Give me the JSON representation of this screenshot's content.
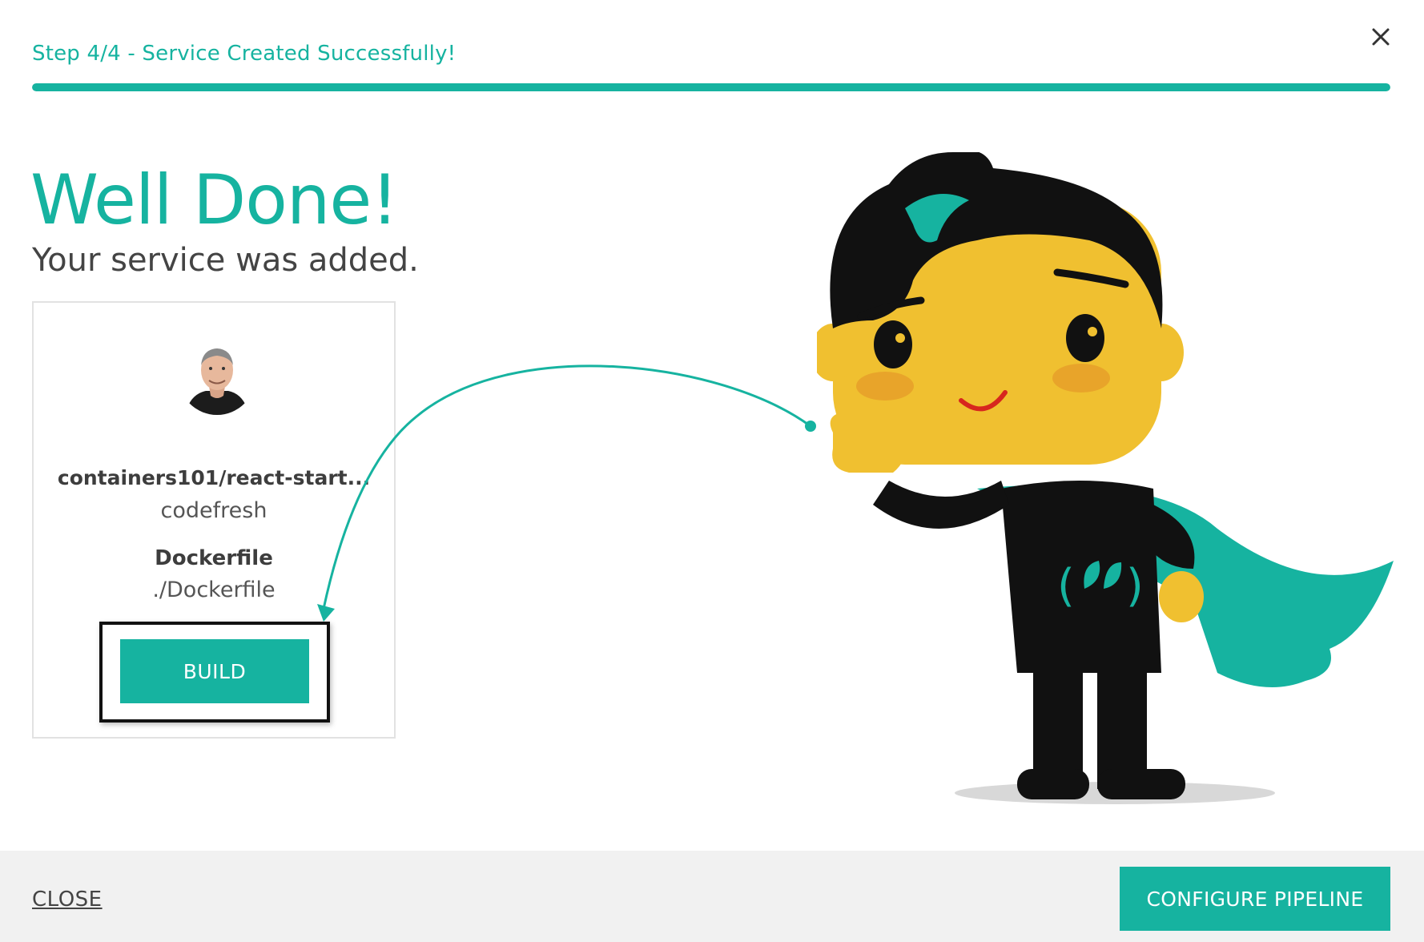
{
  "header": {
    "step_title": "Step 4/4 - Service Created Successfully!",
    "progress": 1.0,
    "close_icon": "close-x-icon"
  },
  "hero": {
    "title": "Well Done!",
    "subtitle": "Your service was added."
  },
  "service_card": {
    "repo": "containers101/react-start...",
    "owner": "codefresh",
    "dockerfile_label": "Dockerfile",
    "dockerfile_path": "./Dockerfile",
    "build_label": "BUILD"
  },
  "footer": {
    "close_label": "CLOSE",
    "configure_label": "CONFIGURE PIPELINE"
  },
  "colors": {
    "accent": "#16b3a0",
    "footer_bg": "#f1f1f1",
    "mascot_skin": "#f0c030",
    "mascot_cheek": "#e8a42a"
  }
}
